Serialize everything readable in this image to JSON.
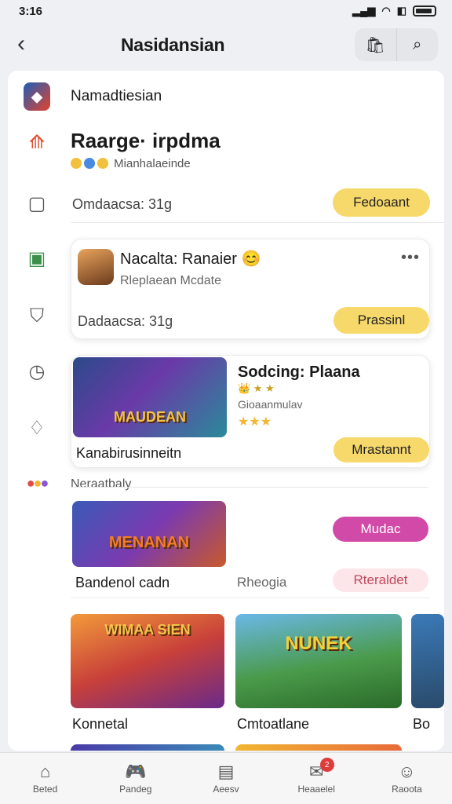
{
  "status": {
    "time": "3:16",
    "signal": "▂▄▆",
    "wifi": "◠",
    "network": "◧"
  },
  "header": {
    "back": "‹",
    "title": "Nasidansian",
    "bag_icon": "🛍",
    "search_icon": "⌕"
  },
  "side_rail": [
    "app-logo",
    "chart-icon",
    "image-icon",
    "shield-icon",
    "clock-icon",
    "bell-icon",
    "dots-icon"
  ],
  "top": {
    "label": "Namadtiesian",
    "title": "Raarge· irpdma",
    "badges": "Mianhalaeinde",
    "sub": "Omdaacsa: 31g",
    "button": "Fedoaant"
  },
  "card1": {
    "title": "Nacalta: Ranaier",
    "emoji": "😊",
    "sub": "Rleplaean Mcdate",
    "more": "•••",
    "meta": "Dadaacsa: 31g",
    "button": "Prassinl"
  },
  "card2": {
    "thumb_text": "MAUDEAN",
    "title": "Sodcing: Plaana",
    "rating_text": "👑 ★ ★",
    "sub": "Gioaanmulav",
    "stars": "★★★",
    "caption": "Kanabirusinneitn",
    "button": "Mrastannt"
  },
  "section": {
    "label": "Neraatbaly"
  },
  "card3": {
    "thumb_text": "MENANAN",
    "caption": "Bandenol cadn",
    "mid": "Rheogia",
    "button_magenta": "Mudac",
    "button_pink": "Rteraldet"
  },
  "grid": [
    {
      "thumb_text": "WIMAA SIEN",
      "caption": "Konnetal"
    },
    {
      "thumb_text": "NUNEK",
      "caption": "Cmtoatlane"
    },
    {
      "caption": "Bo"
    }
  ],
  "bottom_nav": [
    {
      "label": "Beted",
      "icon": "⌂"
    },
    {
      "label": "Pandeg",
      "icon": "🎮"
    },
    {
      "label": "Aeesv",
      "icon": "▤"
    },
    {
      "label": "Heaaelel",
      "icon": "✉",
      "badge": "2"
    },
    {
      "label": "Raoota",
      "icon": "☺"
    }
  ],
  "colors": {
    "accent_yellow": "#f7d86a",
    "accent_magenta": "#d24aa8",
    "accent_pink": "#fde6ea"
  }
}
